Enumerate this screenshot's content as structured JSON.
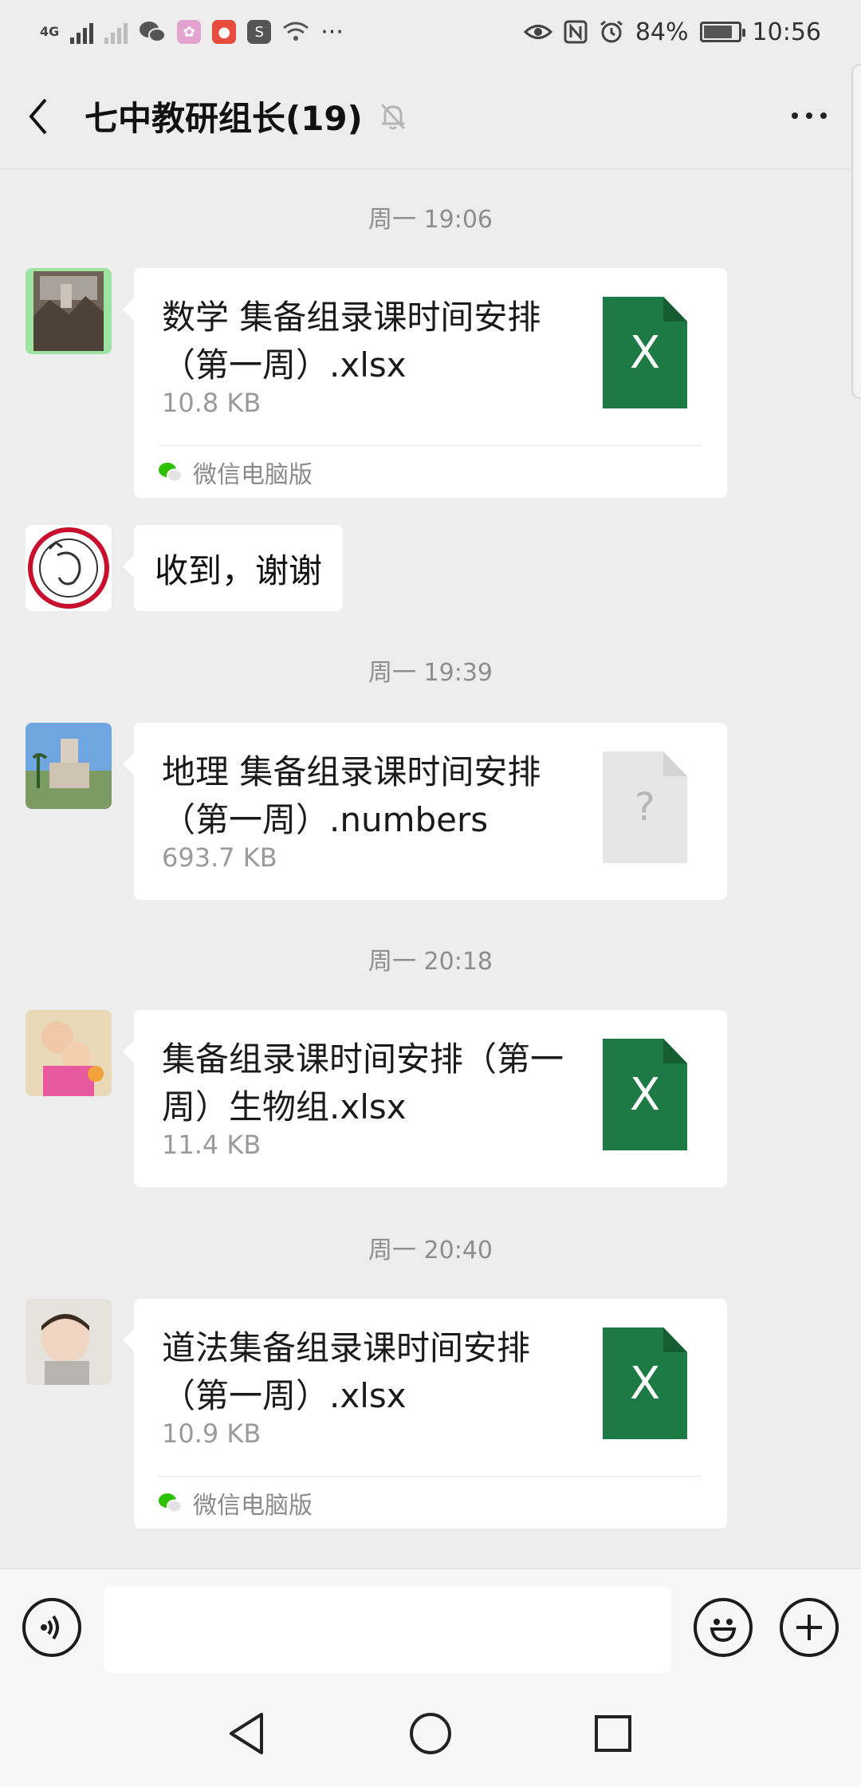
{
  "status_bar": {
    "network": "4G",
    "battery": "84%",
    "battery_level": 0.84,
    "time": "10:56",
    "more": "···"
  },
  "header": {
    "title": "七中教研组长(19)"
  },
  "messages": [
    {
      "type": "timestamp",
      "text": "周一 19:06"
    },
    {
      "type": "file",
      "file_name": "数学 集备组录课时间安排（第一周）.xlsx",
      "file_size": "10.8 KB",
      "file_icon": "excel-icon",
      "icon_letter": "X",
      "source": "微信电脑版"
    },
    {
      "type": "text",
      "text": "收到，谢谢"
    },
    {
      "type": "timestamp",
      "text": "周一 19:39"
    },
    {
      "type": "file",
      "file_name": "地理 集备组录课时间安排（第一周）.numbers",
      "file_size": "693.7 KB",
      "file_icon": "unknown-file-icon",
      "icon_letter": "?"
    },
    {
      "type": "timestamp",
      "text": "周一 20:18"
    },
    {
      "type": "file",
      "file_name": "集备组录课时间安排（第一周）生物组.xlsx",
      "file_size": "11.4 KB",
      "file_icon": "excel-icon",
      "icon_letter": "X"
    },
    {
      "type": "timestamp",
      "text": "周一 20:40"
    },
    {
      "type": "file",
      "file_name": "道法集备组录课时间安排（第一周）.xlsx",
      "file_size": "10.9 KB",
      "file_icon": "excel-icon",
      "icon_letter": "X",
      "source": "微信电脑版"
    }
  ],
  "input_bar": {
    "placeholder": ""
  },
  "colors": {
    "excel_green": "#1e7a45",
    "chat_background": "#ededed",
    "wechat_green": "#2dc100"
  }
}
